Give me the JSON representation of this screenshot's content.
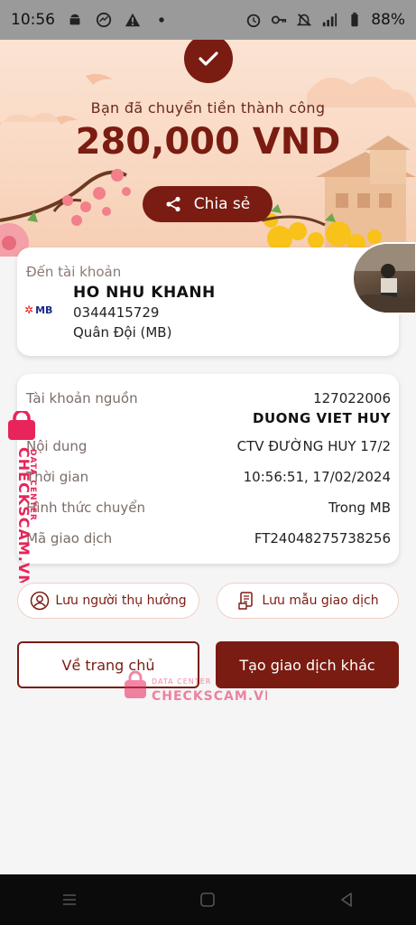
{
  "status_bar": {
    "time": "10:56",
    "battery": "88%",
    "left_icons": [
      "android-icon",
      "messenger-icon",
      "warning-icon",
      "dot-icon"
    ],
    "right_icons": [
      "alarm-icon",
      "key-icon",
      "mute-icon",
      "signal-icon",
      "battery-icon"
    ]
  },
  "hero": {
    "success_text": "Bạn đã chuyển tiền thành công",
    "amount": "280,000 VND",
    "share_label": "Chia sẻ"
  },
  "recipient": {
    "to_label": "Đến tài khoản",
    "bank_logo_text": "MB",
    "name": "HO NHU KHANH",
    "account": "0344415729",
    "bank": "Quân Đội (MB)"
  },
  "details": {
    "source_label": "Tài khoản nguồn",
    "source_account": "127022006",
    "source_name": "DUONG VIET HUY",
    "content_label": "Nội dung",
    "content_value": "CTV ĐƯỜNG HUY 17/2",
    "time_label": "Thời gian",
    "time_value": "10:56:51, 17/02/2024",
    "method_label": "Hình thức chuyển",
    "method_value": "Trong MB",
    "txn_label": "Mã giao dịch",
    "txn_value": "FT24048275738256"
  },
  "actions": {
    "save_recipient": "Lưu người thụ hưởng",
    "save_template": "Lưu mẫu giao dịch",
    "home": "Về trang chủ",
    "new_transaction": "Tạo giao dịch khác"
  },
  "watermark": {
    "side_text": "CHECKSCAM.VN",
    "side_sub": "DATA CENTER",
    "center_sub": "DATA CENTER",
    "center_text": "CHECKSCAM.VN"
  },
  "colors": {
    "brand": "#7a1c12",
    "hero_bg": "#f9d8c2",
    "watermark": "#e8245a"
  }
}
